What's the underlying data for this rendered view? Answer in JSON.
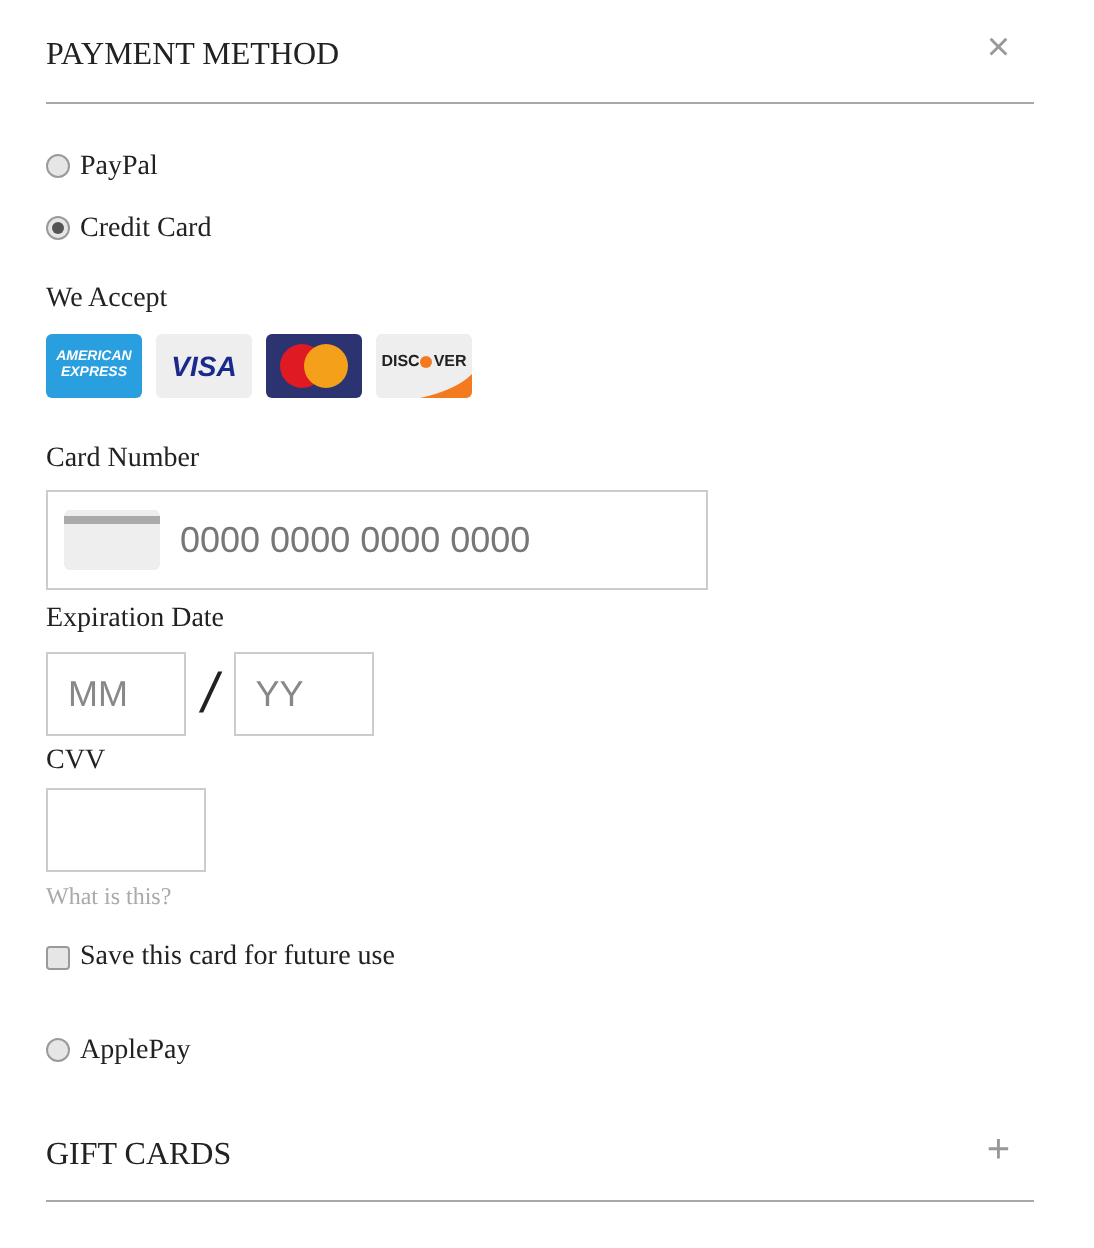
{
  "header": {
    "title": "PAYMENT METHOD",
    "close": "×"
  },
  "methods_top": [
    {
      "label": "PayPal",
      "selected": false
    },
    {
      "label": "Credit Card",
      "selected": true
    }
  ],
  "accept_label": "We Accept",
  "logos": [
    {
      "kind": "amex",
      "lines": [
        "AMERICAN",
        "EXPRESS"
      ]
    },
    {
      "kind": "visa",
      "lines": [
        "VISA"
      ]
    },
    {
      "kind": "mastercard"
    },
    {
      "kind": "discover",
      "lines": [
        "DISC",
        "VER"
      ]
    }
  ],
  "card_number": {
    "label": "Card Number",
    "placeholder": "0000 0000 0000 0000"
  },
  "expiration": {
    "label": "Expiration Date",
    "month_placeholder": "MM",
    "separator": "/",
    "year_placeholder": "YY"
  },
  "cvv": {
    "label": "CVV",
    "help_link": "What is this?"
  },
  "save_card": {
    "label": "Save this card for future use",
    "checked": false
  },
  "methods_bottom": [
    {
      "label": "ApplePay",
      "selected": false
    }
  ],
  "gift_cards": {
    "title": "GIFT CARDS",
    "toggle": "+"
  }
}
